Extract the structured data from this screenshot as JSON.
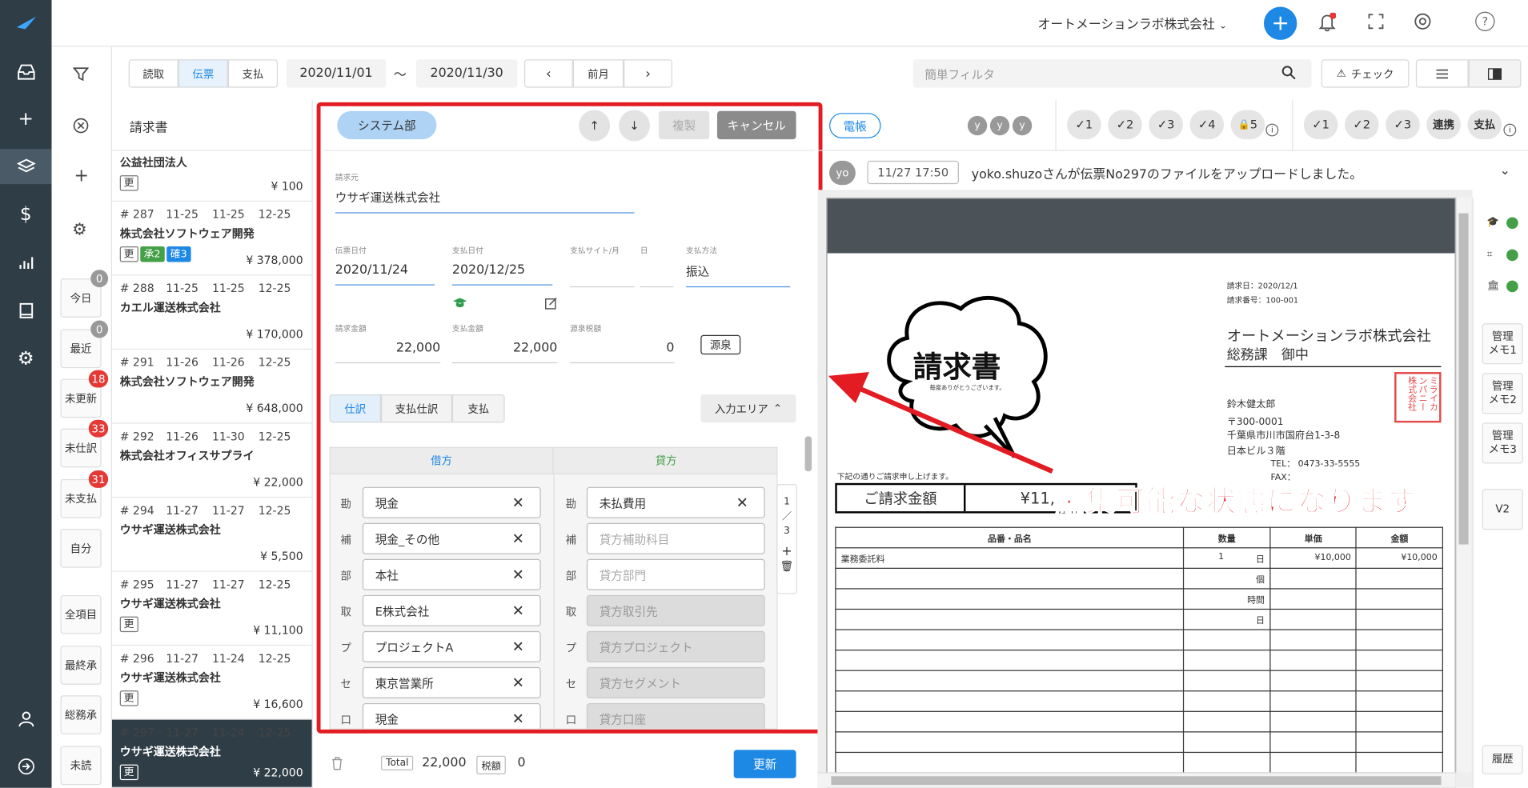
{
  "app": {
    "company": "オートメーションラボ株式会社"
  },
  "toolbar": {
    "tabs": [
      "読取",
      "伝票",
      "支払"
    ],
    "active_tab": "伝票",
    "date_from": "2020/11/01",
    "date_sep": "〜",
    "date_to": "2020/11/30",
    "prev_month": "前月",
    "filter_placeholder": "簡単フィルタ",
    "check_label": "チェック"
  },
  "filters": [
    {
      "label": "今日",
      "count": "0",
      "badge": "gray"
    },
    {
      "label": "最近",
      "count": "0",
      "badge": "gray"
    },
    {
      "label": "未更新",
      "count": "18",
      "badge": "red"
    },
    {
      "label": "未仕訳",
      "count": "33",
      "badge": "red"
    },
    {
      "label": "未支払",
      "count": "31",
      "badge": "red"
    },
    {
      "label": "自分",
      "count": "",
      "badge": ""
    },
    {
      "label": "全項目",
      "count": "",
      "badge": ""
    },
    {
      "label": "最終承",
      "count": "",
      "badge": ""
    },
    {
      "label": "総務承",
      "count": "",
      "badge": ""
    },
    {
      "label": "未読",
      "count": "",
      "badge": ""
    }
  ],
  "list": {
    "header": "請求書",
    "items": [
      {
        "no": "",
        "d1": "",
        "d2": "",
        "d3": "",
        "name": "公益社団法人",
        "tags": [
          "更"
        ],
        "amount": "¥ 100"
      },
      {
        "no": "# 287",
        "d1": "11-25",
        "d2": "11-25",
        "d3": "12-25",
        "name": "株式会社ソフトウェア開発",
        "tags": [
          "更",
          "承2",
          "確3"
        ],
        "amount": "¥ 378,000"
      },
      {
        "no": "# 288",
        "d1": "11-25",
        "d2": "11-25",
        "d3": "12-25",
        "name": "カエル運送株式会社",
        "tags": [],
        "amount": "¥ 170,000"
      },
      {
        "no": "# 291",
        "d1": "11-26",
        "d2": "11-26",
        "d3": "12-25",
        "name": "株式会社ソフトウェア開発",
        "tags": [],
        "amount": "¥ 648,000"
      },
      {
        "no": "# 292",
        "d1": "11-26",
        "d2": "11-30",
        "d3": "12-25",
        "name": "株式会社オフィスサプライ",
        "tags": [],
        "amount": "¥ 22,000"
      },
      {
        "no": "# 294",
        "d1": "11-27",
        "d2": "11-27",
        "d3": "12-25",
        "name": "ウサギ運送株式会社",
        "tags": [],
        "amount": "¥ 5,500"
      },
      {
        "no": "# 295",
        "d1": "11-27",
        "d2": "11-27",
        "d3": "12-25",
        "name": "ウサギ運送株式会社",
        "tags": [
          "更"
        ],
        "amount": "¥ 11,100"
      },
      {
        "no": "# 296",
        "d1": "11-27",
        "d2": "11-24",
        "d3": "12-25",
        "name": "ウサギ運送株式会社",
        "tags": [
          "更"
        ],
        "amount": "¥ 16,600"
      },
      {
        "no": "# 297",
        "d1": "11-27",
        "d2": "11-24",
        "d3": "12-25",
        "name": "ウサギ運送株式会社",
        "tags": [
          "更"
        ],
        "amount": "¥ 22,000"
      }
    ]
  },
  "form": {
    "dept": "システム部",
    "copy": "複製",
    "cancel": "キャンセル",
    "vendor_label": "請求元",
    "vendor": "ウサギ運送株式会社",
    "slip_date_label": "伝票日付",
    "slip_date": "2020/11/24",
    "pay_date_label": "支払日付",
    "pay_date": "2020/12/25",
    "site_label": "支払サイト/月",
    "day_label": "日",
    "method_label": "支払方法",
    "method": "振込",
    "inv_amt_label": "請求金額",
    "inv_amt": "22,000",
    "pay_amt_label": "支払金額",
    "pay_amt": "22,000",
    "wh_label": "源泉税額",
    "wh": "0",
    "wh_btn": "源泉",
    "subtabs": [
      "仕訳",
      "支払仕訳",
      "支払"
    ],
    "area": "入力エリア",
    "debit": "借方",
    "credit": "貸方",
    "rows": [
      {
        "k": "勘",
        "debit": "現金",
        "credit": "未払費用",
        "ctype": "val"
      },
      {
        "k": "補",
        "debit": "現金_その他",
        "credit": "貸方補助科目",
        "ctype": "ph"
      },
      {
        "k": "部",
        "debit": "本社",
        "credit": "貸方部門",
        "ctype": "ph"
      },
      {
        "k": "取",
        "debit": "E株式会社",
        "credit": "貸方取引先",
        "ctype": "gray"
      },
      {
        "k": "プ",
        "debit": "プロジェクトA",
        "credit": "貸方プロジェクト",
        "ctype": "gray"
      },
      {
        "k": "セ",
        "debit": "東京営業所",
        "credit": "貸方セグメント",
        "ctype": "gray"
      },
      {
        "k": "口",
        "debit": "現金",
        "credit": "貸方口座",
        "ctype": "gray"
      }
    ],
    "page_1": "1",
    "page_sep": "／",
    "page_2": "3",
    "total_label": "Total",
    "total": "22,000",
    "tax_label": "税額",
    "tax": "0",
    "update": "更新"
  },
  "right": {
    "ledger": "電帳",
    "y": [
      "y",
      "y",
      "y"
    ],
    "checks1": [
      "1",
      "2",
      "3",
      "4",
      "5"
    ],
    "checks2": [
      "1",
      "2",
      "3"
    ],
    "linked": "連携",
    "pay": "支払",
    "user": "yo",
    "time": "11/27 17:50",
    "message": "yoko.shuzoさんが伝票No297のファイルをアップロードしました。"
  },
  "memos": [
    "管理\nメモ1",
    "管理\nメモ2",
    "管理\nメモ3"
  ],
  "v2": "V2",
  "history": "履歴",
  "invoice": {
    "title": "請求書",
    "thanks": "毎度ありがとうございます。",
    "date": "請求日：2020/12/1",
    "no": "請求番号：100-001",
    "to1": "オートメーションラボ株式会社",
    "to2": "総務課　御中",
    "from": "鈴木健太郎",
    "zip": "〒300-0001",
    "addr": "千葉県市川市国府台1-3-8",
    "bldg": "日本ビル３階",
    "tel": "TEL： 0473-33-5555",
    "fax": "FAX：",
    "intro": "下記の通りご請求申し上げます。",
    "amount_label": "ご請求金額",
    "amount": "¥11,",
    "cols": [
      "品番・品名",
      "数量",
      "単価",
      "金額"
    ],
    "row1": [
      "業務委託料",
      "1",
      "日",
      "¥10,000",
      "¥10,000"
    ],
    "units": [
      "個",
      "時間",
      "日"
    ],
    "stamp": "ミライカンパニー株式会社"
  },
  "annotation": "編集可能な状態になります。"
}
